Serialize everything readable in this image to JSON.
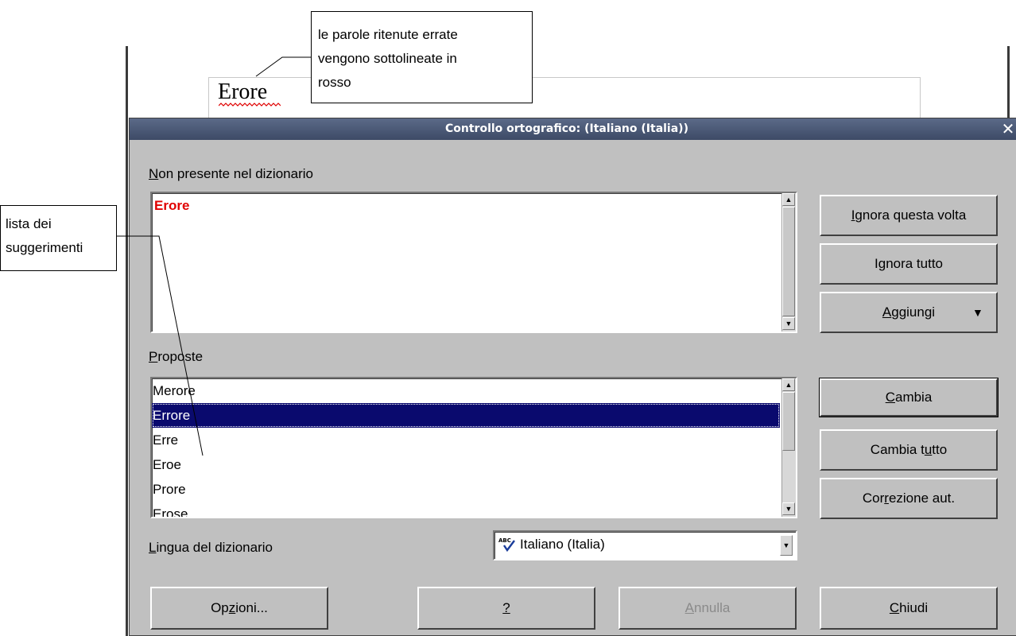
{
  "document": {
    "misspelled_word": "Erore"
  },
  "callouts": {
    "underline_note": [
      "le parole ritenute errate",
      "vengono sottolineate in",
      "rosso"
    ],
    "suggestions_note": [
      "lista dei",
      "suggerimenti"
    ]
  },
  "dialog": {
    "title": "Controllo ortografico:  (Italiano (Italia))",
    "not_in_dictionary_label": {
      "u": "N",
      "rest": "on presente nel dizionario"
    },
    "not_in_dictionary_value": "Erore",
    "suggestions_label": {
      "u": "P",
      "rest": "roposte"
    },
    "suggestions": [
      "Merore",
      "Errore",
      "Erre",
      "Eroe",
      "Prore",
      "Erose"
    ],
    "selected_suggestion": "Errore",
    "language_label": {
      "u": "L",
      "rest": "ingua del dizionario"
    },
    "language_value": "Italiano (Italia)",
    "buttons": {
      "ignore_once": {
        "u": "I",
        "rest": "gnora questa volta"
      },
      "ignore_all": {
        "pre": "I",
        "u": "g",
        "rest": "nora tutto"
      },
      "add": {
        "u": "A",
        "rest": "ggiungi"
      },
      "change": {
        "u": "C",
        "rest": "ambia"
      },
      "change_all": {
        "pre": "Cambia t",
        "u": "u",
        "rest": "tto"
      },
      "autocorrect": {
        "pre": "Cor",
        "u": "r",
        "rest": "ezione aut."
      },
      "options": {
        "pre": "Op",
        "u": "z",
        "rest": "ioni..."
      },
      "help": {
        "u": "?"
      },
      "undo": {
        "u": "A",
        "rest": "nnulla"
      },
      "close": {
        "u": "C",
        "rest": "hiudi"
      }
    }
  },
  "colors": {
    "misspelled": "#e00000",
    "selection": "#0a0a6e",
    "titlebar": "#4a5775"
  },
  "icons": {
    "close": "close-icon",
    "dropdown": "triangle-down-icon",
    "spellcheck": "abc-check-icon"
  }
}
